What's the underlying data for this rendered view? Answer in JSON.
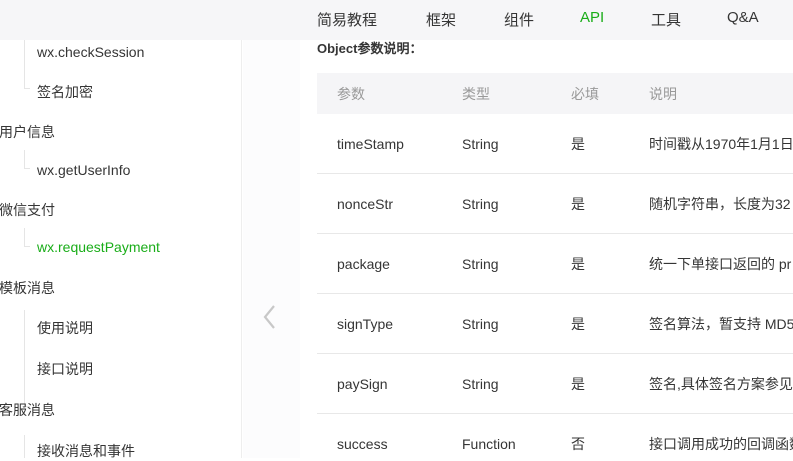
{
  "nav": [
    "简易教程",
    "框架",
    "组件",
    "API",
    "工具",
    "Q&A"
  ],
  "nav_active": "API",
  "accent": "#1aad19",
  "sidebar": [
    {
      "label": "wx.checkSession",
      "level": "child"
    },
    {
      "label": "签名加密",
      "level": "child"
    },
    {
      "label": "用户信息",
      "level": "top"
    },
    {
      "label": "wx.getUserInfo",
      "level": "child"
    },
    {
      "label": "微信支付",
      "level": "top"
    },
    {
      "label": "wx.requestPayment",
      "level": "child",
      "active": true
    },
    {
      "label": "模板消息",
      "level": "top"
    },
    {
      "label": "使用说明",
      "level": "child"
    },
    {
      "label": "接口说明",
      "level": "child"
    },
    {
      "label": "客服消息",
      "level": "top"
    },
    {
      "label": "接收消息和事件",
      "level": "child"
    }
  ],
  "main": {
    "subtitle": "Object参数说明：",
    "headers": [
      "参数",
      "类型",
      "必填",
      "说明"
    ],
    "rows": [
      [
        "timeStamp",
        "String",
        "是",
        "时间戳从1970年1月1日"
      ],
      [
        "nonceStr",
        "String",
        "是",
        "随机字符串，长度为32"
      ],
      [
        "package",
        "String",
        "是",
        "统一下单接口返回的 pr"
      ],
      [
        "signType",
        "String",
        "是",
        "签名算法，暂支持 MD5"
      ],
      [
        "paySign",
        "String",
        "是",
        "签名,具体签名方案参见"
      ],
      [
        "success",
        "Function",
        "否",
        "接口调用成功的回调函数"
      ]
    ]
  }
}
